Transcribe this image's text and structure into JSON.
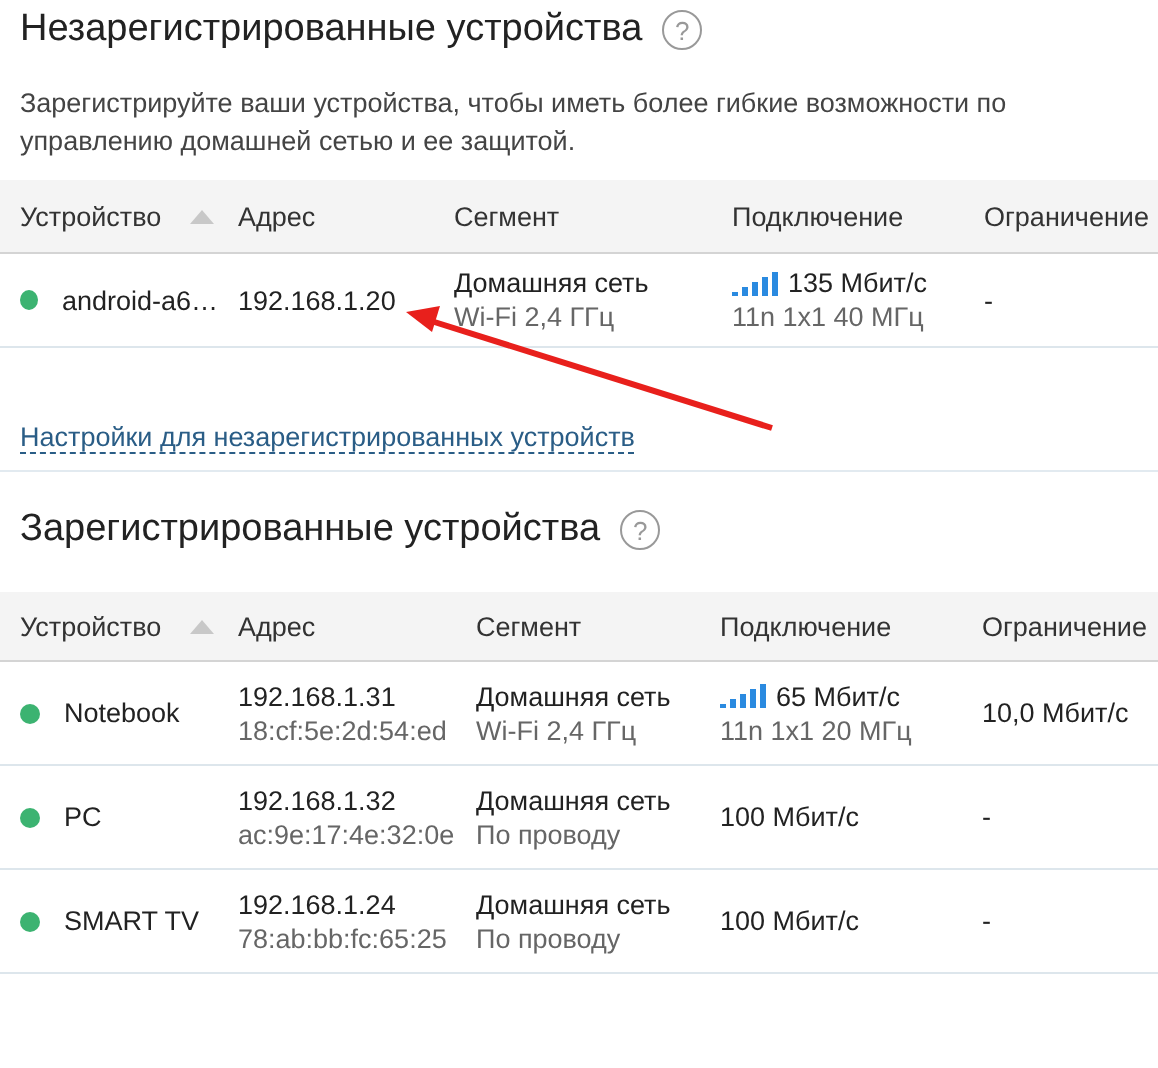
{
  "unregistered": {
    "title": "Незарегистрированные устройства",
    "help": "?",
    "description": "Зарегистрируйте ваши устройства, чтобы иметь более гибкие возможности по управлению  домашней сетью и ее защитой.",
    "columns": [
      {
        "label": "Устройство",
        "sorted": true
      },
      {
        "label": "Адрес",
        "sorted": false
      },
      {
        "label": "Сегмент",
        "sorted": false
      },
      {
        "label": "Подключение",
        "sorted": false
      },
      {
        "label": "Ограничение",
        "sorted": false
      }
    ],
    "rows": [
      {
        "kind": "wireless",
        "online": true,
        "name": "android-a6…",
        "ip": "192.168.1.20",
        "segment": "Домашняя сеть",
        "segment_detail": "Wi-Fi 2,4 ГГц",
        "speed": "135 Мбит/с",
        "speed_detail": "11n 1x1 40 МГц",
        "limit": "-"
      }
    ],
    "settings_link": "Настройки для незарегистрированных устройств"
  },
  "registered": {
    "title": "Зарегистрированные устройства",
    "help": "?",
    "columns": [
      {
        "label": "Устройство",
        "sorted": true
      },
      {
        "label": "Адрес",
        "sorted": false
      },
      {
        "label": "Сегмент",
        "sorted": false
      },
      {
        "label": "Подключение",
        "sorted": false
      },
      {
        "label": "Ограничение",
        "sorted": false
      }
    ],
    "rows": [
      {
        "kind": "wireless",
        "online": true,
        "name": "Notebook",
        "ip": "192.168.1.31",
        "mac": "18:cf:5e:2d:54:ed",
        "segment": "Домашняя сеть",
        "segment_detail": "Wi-Fi 2,4 ГГц",
        "speed": "65 Мбит/с",
        "speed_detail": "11n 1x1 20 МГц",
        "limit": "10,0 Мбит/с"
      },
      {
        "kind": "wired",
        "online": true,
        "name": "PC",
        "ip": "192.168.1.32",
        "mac": "ac:9e:17:4e:32:0e",
        "segment": "Домашняя сеть",
        "segment_detail": "По проводу",
        "speed": "100 Мбит/с",
        "limit": "-"
      },
      {
        "kind": "wired",
        "online": true,
        "name": "SMART TV",
        "ip": "192.168.1.24",
        "mac": "78:ab:bb:fc:65:25",
        "segment": "Домашняя сеть",
        "segment_detail": "По проводу",
        "speed": "100 Мбит/с",
        "limit": "-"
      }
    ]
  }
}
